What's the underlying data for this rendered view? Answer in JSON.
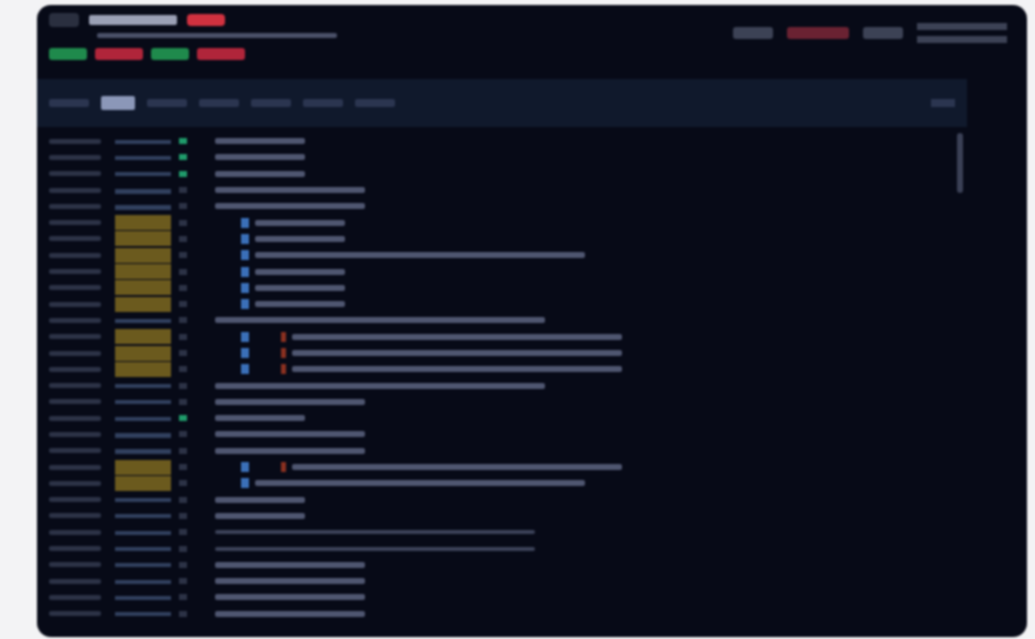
{
  "header": {
    "status_badge": {
      "color": "#d0313f"
    },
    "tags": [
      {
        "color": "#1f8a4c"
      },
      {
        "color": "#b0253a"
      },
      {
        "color": "#1f8a4c"
      },
      {
        "color": "#b0253a"
      }
    ],
    "actions": [
      {
        "kind": "plain"
      },
      {
        "kind": "danger"
      },
      {
        "kind": "plain"
      }
    ]
  },
  "tabs": [
    {
      "selected": false
    },
    {
      "selected": true
    },
    {
      "selected": false
    },
    {
      "selected": false
    },
    {
      "selected": false
    },
    {
      "selected": false
    },
    {
      "selected": false
    }
  ],
  "rows": [
    {
      "highlighted": false,
      "ok": true,
      "badge": false,
      "flag": false,
      "kind": "short"
    },
    {
      "highlighted": false,
      "ok": true,
      "badge": false,
      "flag": false,
      "kind": "short"
    },
    {
      "highlighted": false,
      "ok": true,
      "badge": false,
      "flag": false,
      "kind": "short"
    },
    {
      "highlighted": false,
      "ok": false,
      "badge": false,
      "flag": false,
      "kind": "medium"
    },
    {
      "highlighted": false,
      "ok": false,
      "badge": false,
      "flag": false,
      "kind": "medium"
    },
    {
      "highlighted": true,
      "ok": false,
      "badge": true,
      "flag": false,
      "kind": "short"
    },
    {
      "highlighted": true,
      "ok": false,
      "badge": true,
      "flag": false,
      "kind": "short"
    },
    {
      "highlighted": true,
      "ok": false,
      "badge": true,
      "flag": false,
      "kind": "long"
    },
    {
      "highlighted": true,
      "ok": false,
      "badge": true,
      "flag": false,
      "kind": "short"
    },
    {
      "highlighted": true,
      "ok": false,
      "badge": true,
      "flag": false,
      "kind": "short"
    },
    {
      "highlighted": true,
      "ok": false,
      "badge": true,
      "flag": false,
      "kind": "short"
    },
    {
      "highlighted": false,
      "ok": false,
      "badge": false,
      "flag": false,
      "kind": "long"
    },
    {
      "highlighted": true,
      "ok": false,
      "badge": true,
      "flag": true,
      "kind": "long"
    },
    {
      "highlighted": true,
      "ok": false,
      "badge": true,
      "flag": true,
      "kind": "long"
    },
    {
      "highlighted": true,
      "ok": false,
      "badge": true,
      "flag": true,
      "kind": "long"
    },
    {
      "highlighted": false,
      "ok": false,
      "badge": false,
      "flag": false,
      "kind": "long"
    },
    {
      "highlighted": false,
      "ok": false,
      "badge": false,
      "flag": false,
      "kind": "medium"
    },
    {
      "highlighted": false,
      "ok": true,
      "badge": false,
      "flag": false,
      "kind": "short"
    },
    {
      "highlighted": false,
      "ok": false,
      "badge": false,
      "flag": false,
      "kind": "medium"
    },
    {
      "highlighted": false,
      "ok": false,
      "badge": false,
      "flag": false,
      "kind": "medium"
    },
    {
      "highlighted": true,
      "ok": false,
      "badge": true,
      "flag": true,
      "kind": "long"
    },
    {
      "highlighted": true,
      "ok": false,
      "badge": true,
      "flag": false,
      "kind": "long"
    },
    {
      "highlighted": false,
      "ok": false,
      "badge": false,
      "flag": false,
      "kind": "short"
    },
    {
      "highlighted": false,
      "ok": false,
      "badge": false,
      "flag": false,
      "kind": "short"
    },
    {
      "highlighted": false,
      "ok": false,
      "badge": false,
      "flag": false,
      "kind": "rule"
    },
    {
      "highlighted": false,
      "ok": false,
      "badge": false,
      "flag": false,
      "kind": "rule"
    },
    {
      "highlighted": false,
      "ok": false,
      "badge": false,
      "flag": false,
      "kind": "medium"
    },
    {
      "highlighted": false,
      "ok": false,
      "badge": false,
      "flag": false,
      "kind": "medium"
    },
    {
      "highlighted": false,
      "ok": false,
      "badge": false,
      "flag": false,
      "kind": "medium"
    },
    {
      "highlighted": false,
      "ok": false,
      "badge": false,
      "flag": false,
      "kind": "medium"
    }
  ]
}
